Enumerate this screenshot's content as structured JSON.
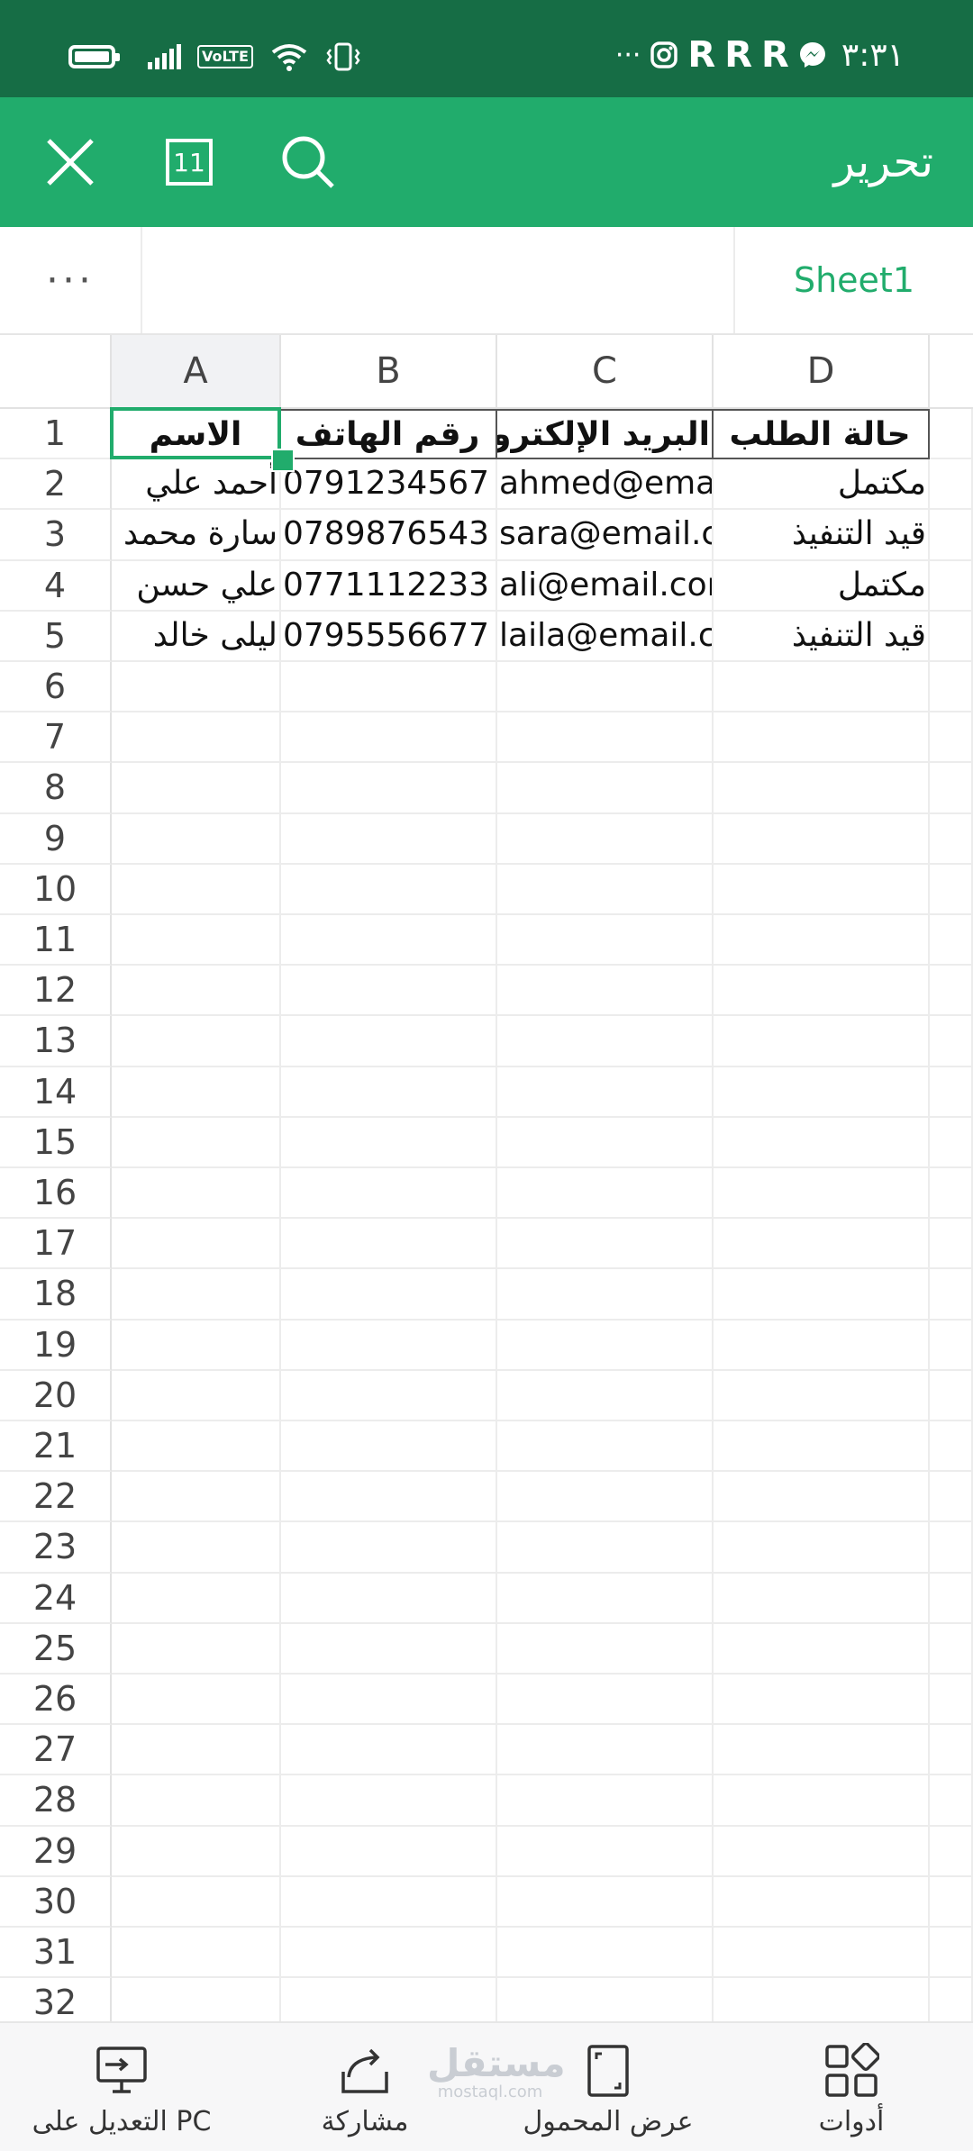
{
  "status_bar": {
    "time": "٣:٣١",
    "volte": "VoLTE",
    "more": "···",
    "icons": [
      "battery-icon",
      "signal-icon",
      "volte-icon",
      "wifi-icon",
      "vibrate-icon",
      "instagram-icon",
      "r-app-icon",
      "messenger-icon"
    ],
    "r_glyph": "R"
  },
  "toolbar": {
    "title": "تحرير",
    "page_count": "11",
    "color": "#21ac6c"
  },
  "sheet_tabs": {
    "more": "···",
    "active_sheet": "Sheet1"
  },
  "grid": {
    "columns": [
      "A",
      "B",
      "C",
      "D"
    ],
    "row_numbers": [
      "1",
      "2",
      "3",
      "4",
      "5",
      "6",
      "7",
      "8",
      "9",
      "10",
      "11",
      "12",
      "13",
      "14",
      "15",
      "16",
      "17",
      "18",
      "19",
      "20",
      "21",
      "22",
      "23",
      "24",
      "25",
      "26",
      "27",
      "28",
      "29",
      "30",
      "31",
      "32"
    ],
    "rows": [
      [
        "الاسم",
        "رقم الهاتف",
        "البريد الإلكتروني",
        "حالة الطلب"
      ],
      [
        "أحمد علي",
        "0791234567",
        "ahmed@email.com",
        "مكتمل"
      ],
      [
        "سارة محمد",
        "0789876543",
        "sara@email.com",
        "قيد التنفيذ"
      ],
      [
        "علي حسن",
        "0771112233",
        "ali@email.com",
        "مكتمل"
      ],
      [
        "ليلى خالد",
        "0795556677",
        "laila@email.com",
        "قيد التنفيذ"
      ]
    ],
    "selected_cell": "A1"
  },
  "bottom_bar": {
    "items": [
      {
        "label": "التعديل على PC",
        "icon": "pc-edit-icon"
      },
      {
        "label": "مشاركة",
        "icon": "share-icon"
      },
      {
        "label": "عرض المحمول",
        "icon": "mobile-view-icon"
      },
      {
        "label": "أدوات",
        "icon": "tools-icon"
      }
    ],
    "watermark": {
      "text": "مستقل",
      "sub": "mostaql.com"
    }
  }
}
